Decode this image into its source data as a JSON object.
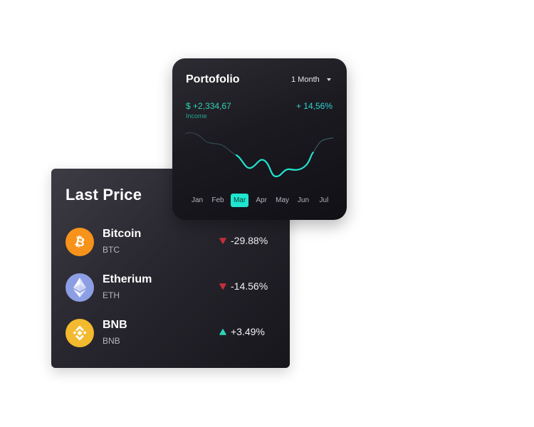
{
  "last_price": {
    "title": "Last Price",
    "coins": [
      {
        "name": "Bitcoin",
        "symbol": "BTC",
        "change": "-29.88%",
        "direction": "down",
        "logo_color": "#f7931a",
        "icon": "bitcoin-icon"
      },
      {
        "name": "Etherium",
        "symbol": "ETH",
        "change": "-14.56%",
        "direction": "down",
        "logo_color": "#8c9ee4",
        "icon": "ethereum-icon"
      },
      {
        "name": "BNB",
        "symbol": "BNB",
        "change": "+3.49%",
        "direction": "up",
        "logo_color": "#f3ba2f",
        "icon": "bnb-icon"
      }
    ]
  },
  "portfolio": {
    "title": "Portofolio",
    "period": "1 Month",
    "income_value": "$ +2,334,67",
    "income_label": "Income",
    "income_change": "+ 14,56%",
    "months": [
      "Jan",
      "Feb",
      "Mar",
      "Apr",
      "May",
      "Jun",
      "Jul"
    ],
    "active_month": "Mar"
  },
  "colors": {
    "accent": "#1fe6cf",
    "positive": "#2ed3b7",
    "negative": "#c4303a"
  }
}
